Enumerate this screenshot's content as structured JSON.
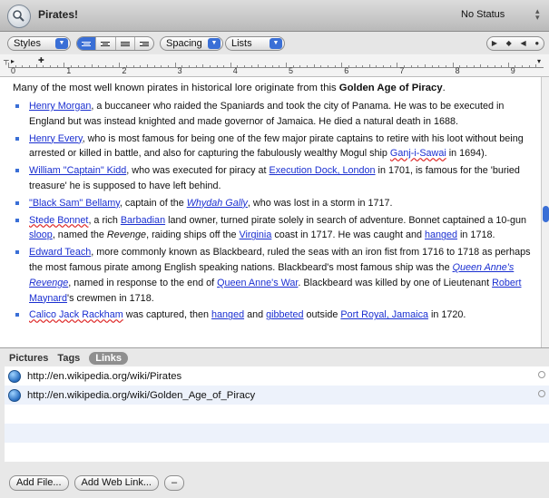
{
  "window": {
    "title": "Pirates!",
    "status": "No Status"
  },
  "toolbar": {
    "styles_label": "Styles",
    "spacing_label": "Spacing",
    "lists_label": "Lists"
  },
  "ruler": {
    "numbers": [
      "0",
      "1",
      "2",
      "3",
      "4",
      "5",
      "6",
      "7",
      "8",
      "9"
    ]
  },
  "doc": {
    "intro": "Many of the most well known pirates in historical lore originate from this ",
    "intro_bold": "Golden Age of Piracy",
    "intro_end": ".",
    "b1": {
      "l1": "Henry Morgan",
      "t1": ", a buccaneer who raided the Spaniards and took the city of Panama. He was to be executed in England but was instead knighted and made governor of Jamaica. He died a natural death in 1688."
    },
    "b2": {
      "l1": "Henry Every",
      "t1": ", who is most famous for being one of the few major pirate captains to retire with his loot without being arrested or killed in battle, and also for capturing the fabulously wealthy Mogul ship ",
      "l2": "Ganj-i-Sawai",
      "t2": " in 1694)."
    },
    "b3": {
      "l1": "William \"Captain\" Kidd",
      "t1": ", who was executed for piracy at ",
      "l2": "Execution Dock, London",
      "t2": " in 1701, is famous for the 'buried treasure' he is supposed to have left behind."
    },
    "b4": {
      "l1": "\"Black Sam\" Bellamy",
      "t1": ", captain of the ",
      "l2": "Whydah Gally",
      "t2": ", who was lost in a storm in 1717."
    },
    "b5": {
      "l1": "Stede Bonnet",
      "t1": ", a rich ",
      "l2": "Barbadian",
      "t2": " land owner, turned pirate solely in search of adventure. Bonnet captained a 10-gun ",
      "l3": "sloop",
      "t3": ", named the ",
      "i1": "Revenge",
      "t4": ", raiding ships off the ",
      "l4": "Virginia",
      "t5": " coast in 1717. He was caught and ",
      "l5": "hanged",
      "t6": " in 1718."
    },
    "b6": {
      "l1": "Edward Teach",
      "t1": ", more commonly known as Blackbeard, ruled the seas with an iron fist from 1716 to 1718 as perhaps the most famous pirate among English speaking nations. Blackbeard's most famous ship was the ",
      "l2": "Queen Anne's Revenge",
      "t2": ", named in response to the end of ",
      "l3": "Queen Anne's War",
      "t3": ". Blackbeard was killed by one of Lieutenant ",
      "l4": "Robert Maynard",
      "t4": "'s crewmen in 1718."
    },
    "b7": {
      "l1": "Calico Jack Rackham",
      "t1": " was captured, then ",
      "l2": "hanged",
      "t2": " and ",
      "l3": "gibbeted",
      "t3": " outside ",
      "l4": "Port Royal, Jamaica",
      "t4": " in 1720."
    }
  },
  "panel": {
    "tabs": [
      "Pictures",
      "Tags",
      "Links"
    ],
    "links": [
      "http://en.wikipedia.org/wiki/Pirates",
      "http://en.wikipedia.org/wiki/Golden_Age_of_Piracy"
    ],
    "buttons": {
      "add_file": "Add File...",
      "add_web_link": "Add Web Link...",
      "remove": "–"
    }
  },
  "colors": {
    "accent": "#3a6fd6",
    "link": "#1a2fd1"
  },
  "icons": [
    "magnifier-icon",
    "globe-icon",
    "search-icon"
  ]
}
